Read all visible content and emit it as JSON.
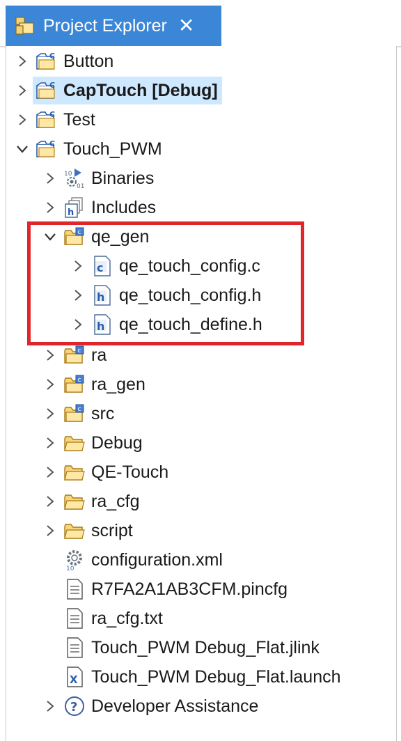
{
  "window": {
    "tab_title": "Project Explorer",
    "tab_icon": "project-explorer-icon",
    "close_icon": "close-icon",
    "accent_color": "#3b86d6",
    "highlight_color": "#e0262b"
  },
  "tree": [
    {
      "label": "Button",
      "icon": "c-project-icon",
      "expanded": false,
      "bold": false
    },
    {
      "label": "CapTouch [Debug]",
      "icon": "c-project-icon",
      "expanded": false,
      "bold": true,
      "selected": true
    },
    {
      "label": "Test",
      "icon": "c-project-icon",
      "expanded": false,
      "bold": false
    },
    {
      "label": "Touch_PWM",
      "icon": "c-project-icon",
      "expanded": true,
      "bold": false
    },
    {
      "label": "Binaries",
      "icon": "binaries-icon",
      "expanded": false
    },
    {
      "label": "Includes",
      "icon": "includes-icon",
      "expanded": false
    },
    {
      "label": "qe_gen",
      "icon": "source-folder-icon",
      "expanded": true
    },
    {
      "label": "qe_touch_config.c",
      "icon": "c-file-icon",
      "expanded": false
    },
    {
      "label": "qe_touch_config.h",
      "icon": "h-file-icon",
      "expanded": false
    },
    {
      "label": "qe_touch_define.h",
      "icon": "h-file-icon",
      "expanded": false
    },
    {
      "label": "ra",
      "icon": "source-folder-icon",
      "expanded": false
    },
    {
      "label": "ra_gen",
      "icon": "source-folder-icon",
      "expanded": false
    },
    {
      "label": "src",
      "icon": "source-folder-icon",
      "expanded": false
    },
    {
      "label": "Debug",
      "icon": "folder-icon",
      "expanded": false
    },
    {
      "label": "QE-Touch",
      "icon": "folder-icon",
      "expanded": false
    },
    {
      "label": "ra_cfg",
      "icon": "folder-icon",
      "expanded": false
    },
    {
      "label": "script",
      "icon": "folder-icon",
      "expanded": false
    },
    {
      "label": "configuration.xml",
      "icon": "config-gear-icon"
    },
    {
      "label": "R7FA2A1AB3CFM.pincfg",
      "icon": "text-file-icon"
    },
    {
      "label": "ra_cfg.txt",
      "icon": "text-file-icon"
    },
    {
      "label": "Touch_PWM Debug_Flat.jlink",
      "icon": "text-file-icon"
    },
    {
      "label": "Touch_PWM Debug_Flat.launch",
      "icon": "launch-file-icon"
    },
    {
      "label": "Developer Assistance",
      "icon": "help-icon",
      "expanded": false
    }
  ]
}
